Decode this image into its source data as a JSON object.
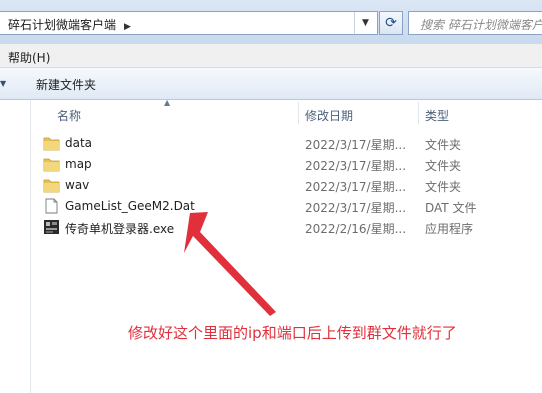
{
  "address_bar": {
    "breadcrumb": "碎石计划微端客户端",
    "crumb_arrow_icon": "chevron-right",
    "dropdown_icon": "chevron-down",
    "refresh_icon": "refresh-arrows"
  },
  "search": {
    "placeholder": "搜索 碎石计划微端客户端",
    "icon": "search-icon"
  },
  "menu": {
    "help": "帮助(H)"
  },
  "toolbar": {
    "new_folder": "新建文件夹"
  },
  "columns": {
    "name": "名称",
    "date": "修改日期",
    "type": "类型"
  },
  "files": [
    {
      "name": "data",
      "date": "2022/3/17/星期...",
      "type": "文件夹",
      "icon": "folder-icon"
    },
    {
      "name": "map",
      "date": "2022/3/17/星期...",
      "type": "文件夹",
      "icon": "folder-icon"
    },
    {
      "name": "wav",
      "date": "2022/3/17/星期...",
      "type": "文件夹",
      "icon": "folder-icon"
    },
    {
      "name": "GameList_GeeM2.Dat",
      "date": "2022/3/17/星期...",
      "type": "DAT 文件",
      "icon": "file-icon"
    },
    {
      "name": "传奇单机登录器.exe",
      "date": "2022/2/16/星期...",
      "type": "应用程序",
      "icon": "app-icon"
    }
  ],
  "annotation": {
    "text": "修改好这个里面的ip和端口后上传到群文件就行了",
    "color": "#e0303b"
  },
  "colors": {
    "title_bar": "#c9d9ee",
    "folder": "#e8c15a",
    "annotation": "#e0303b"
  }
}
